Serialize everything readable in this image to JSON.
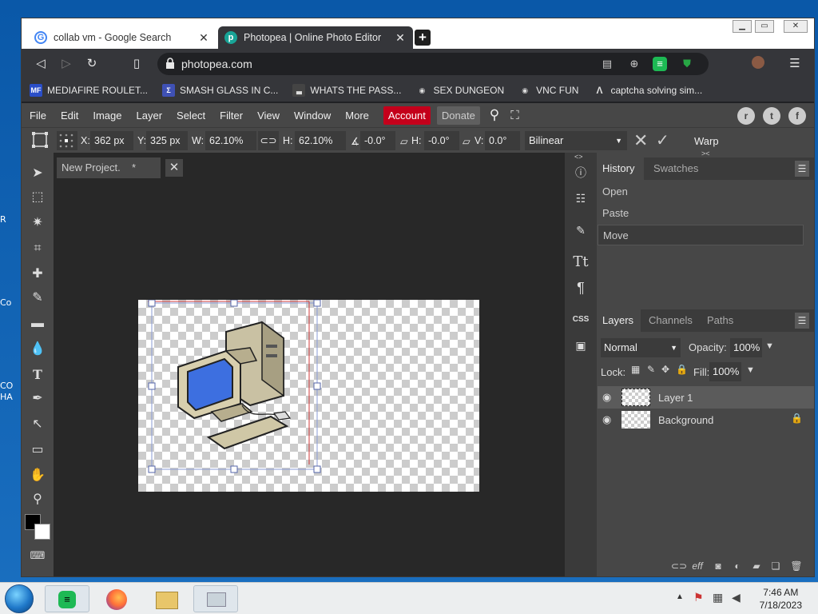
{
  "browser": {
    "tabs": [
      {
        "label": "collab vm - Google Search",
        "close": "✕"
      },
      {
        "label": "Photopea | Online Photo Editor",
        "close": "✕"
      }
    ],
    "new_tab": "+",
    "url": "photopea.com",
    "bookmarks": [
      {
        "label": "MEDIAFIRE ROULET...",
        "icon": "MF",
        "icon_color": "#2a4ec8"
      },
      {
        "label": "SMASH GLASS IN C...",
        "icon": "Σ",
        "icon_color": "#3f51b5"
      },
      {
        "label": "WHATS THE PASS...",
        "icon": "▃",
        "icon_color": "#444444"
      },
      {
        "label": "SEX DUNGEON",
        "icon": "◉",
        "icon_color": "#555555"
      },
      {
        "label": "VNC FUN",
        "icon": "◉",
        "icon_color": "#555555"
      },
      {
        "label": "captcha solving sim...",
        "icon": "Λ",
        "icon_color": "#333333"
      }
    ]
  },
  "menu": {
    "items": [
      "File",
      "Edit",
      "Image",
      "Layer",
      "Select",
      "Filter",
      "View",
      "Window",
      "More"
    ],
    "account": "Account",
    "donate": "Donate"
  },
  "options": {
    "x_label": "X:",
    "x_value": "362 px",
    "y_label": "Y:",
    "y_value": "325 px",
    "w_label": "W:",
    "w_value": "62.10%",
    "h_label": "H:",
    "h_value": "62.10%",
    "angle_value": "-0.0°",
    "skew_h_label": "H:",
    "skew_h_value": "-0.0°",
    "skew_v_label": "V:",
    "skew_v_value": "0.0°",
    "interpolation": "Bilinear",
    "warp": "Warp"
  },
  "document": {
    "tab_label": "New Project.",
    "modified": "*"
  },
  "history": {
    "tabs": [
      "History",
      "Swatches"
    ],
    "items": [
      "Open",
      "Paste",
      "Move"
    ]
  },
  "layers": {
    "tabs": [
      "Layers",
      "Channels",
      "Paths"
    ],
    "blend_mode": "Normal",
    "opacity_label": "Opacity:",
    "opacity_value": "100%",
    "lock_label": "Lock:",
    "fill_label": "Fill:",
    "fill_value": "100%",
    "items": [
      {
        "name": "Layer 1",
        "selected": true
      },
      {
        "name": "Background",
        "locked": true
      }
    ]
  },
  "iconcol": {
    "css_label": "CSS"
  },
  "taskbar": {
    "time": "7:46 AM",
    "date": "7/18/2023"
  }
}
